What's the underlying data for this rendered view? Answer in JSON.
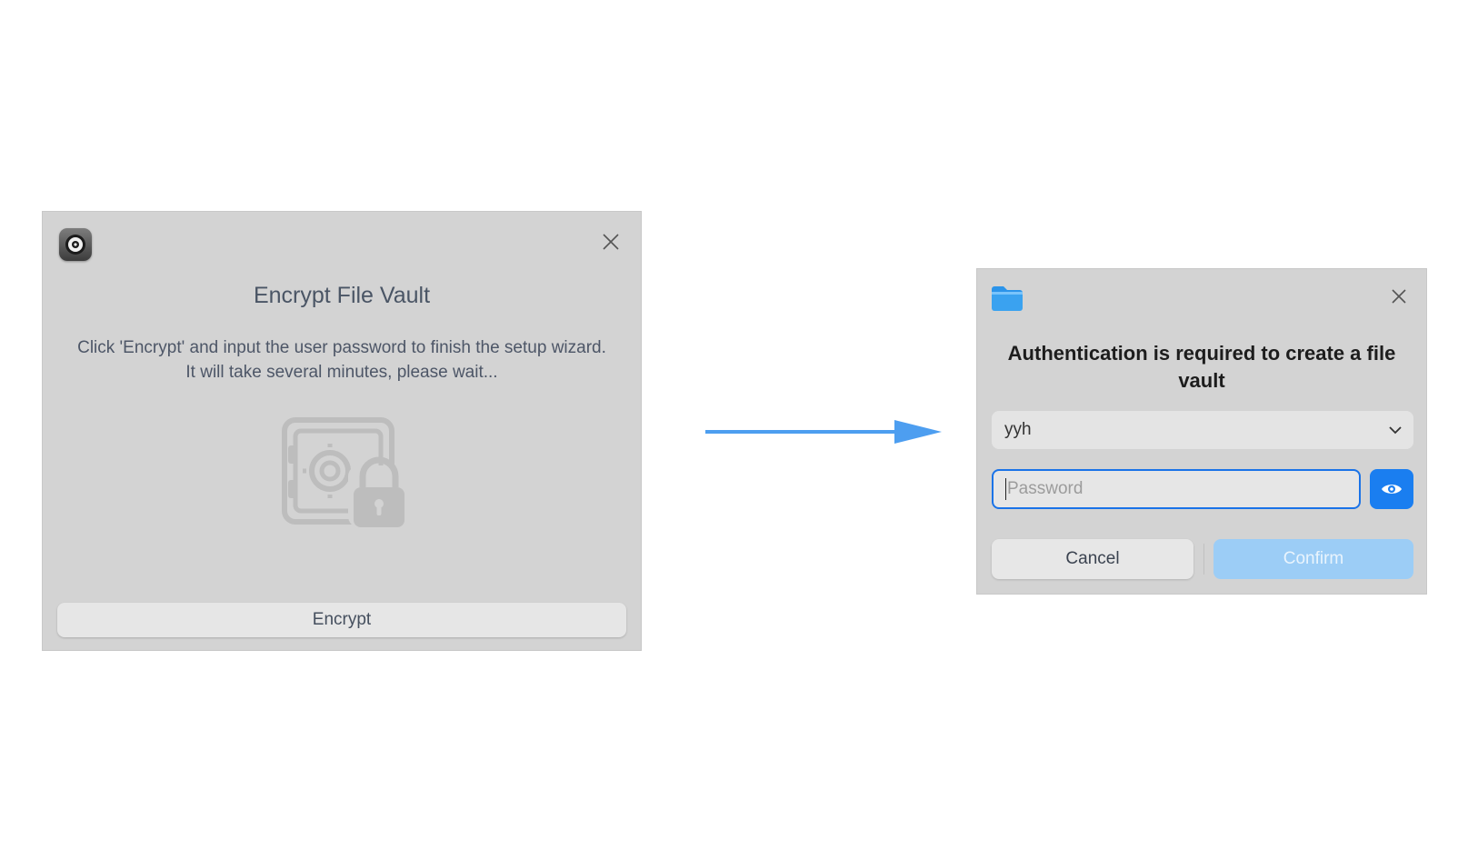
{
  "colors": {
    "dialog_background": "#d3d3d3",
    "accent": "#1a7ef0",
    "arrow": "#4d9ef0",
    "confirm_disabled": "#9ccdf6"
  },
  "vault_dialog": {
    "app_icon": "safe-lock-icon",
    "close_icon": "close-icon",
    "title": "Encrypt File Vault",
    "description_line1": "Click 'Encrypt' and input the user password to finish the setup wizard.",
    "description_line2": "It will take several minutes, please wait...",
    "illustration": "safe-with-padlock",
    "encrypt_label": "Encrypt"
  },
  "arrow": {
    "icon": "right-arrow"
  },
  "auth_dialog": {
    "app_icon": "folder-icon",
    "close_icon": "close-icon",
    "title_line1": "Authentication is required to create a file",
    "title_line2": "vault",
    "user_select": {
      "selected": "yyh",
      "icon": "chevron-down-icon"
    },
    "password_field": {
      "value": "",
      "placeholder": "Password"
    },
    "show_password_icon": "eye-icon",
    "cancel_label": "Cancel",
    "confirm_label": "Confirm"
  }
}
